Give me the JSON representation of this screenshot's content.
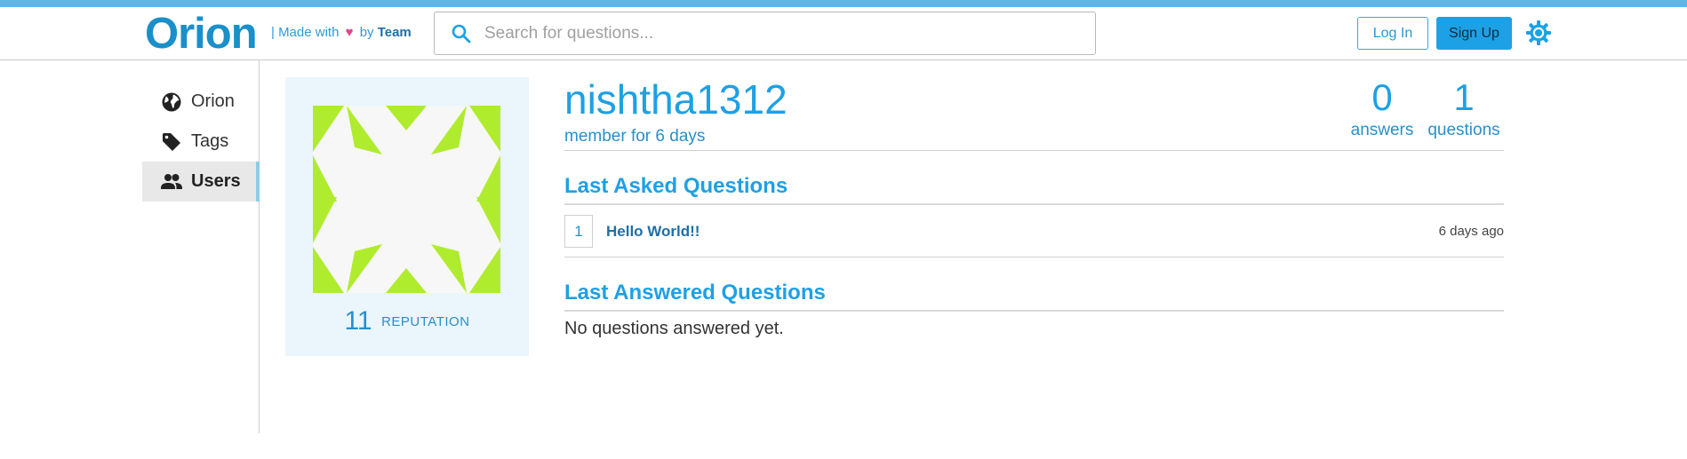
{
  "header": {
    "logo": "Orion",
    "made_prefix": "| Made with",
    "heart": "♥",
    "by": "by",
    "team": "Team",
    "search_placeholder": "Search for questions...",
    "login_label": "Log In",
    "signup_label": "Sign Up"
  },
  "sidebar": {
    "items": [
      {
        "label": "Orion",
        "icon": "globe-icon"
      },
      {
        "label": "Tags",
        "icon": "tag-icon"
      },
      {
        "label": "Users",
        "icon": "users-icon",
        "active": true
      }
    ]
  },
  "profile": {
    "reputation_value": "11",
    "reputation_label": "REPUTATION",
    "username": "nishtha1312",
    "member_since": "member for 6 days",
    "answers_count": "0",
    "answers_label": "answers",
    "questions_count": "1",
    "questions_label": "questions"
  },
  "last_asked": {
    "title": "Last Asked Questions",
    "questions": [
      {
        "count": "1",
        "title": "Hello World!!",
        "time": "6 days ago"
      }
    ]
  },
  "last_answered": {
    "title": "Last Answered Questions",
    "empty_text": "No questions answered yet."
  },
  "colors": {
    "accent": "#1ea0e4",
    "avatar_green": "#b0ec2e",
    "card_bg": "#eaf5fc"
  }
}
